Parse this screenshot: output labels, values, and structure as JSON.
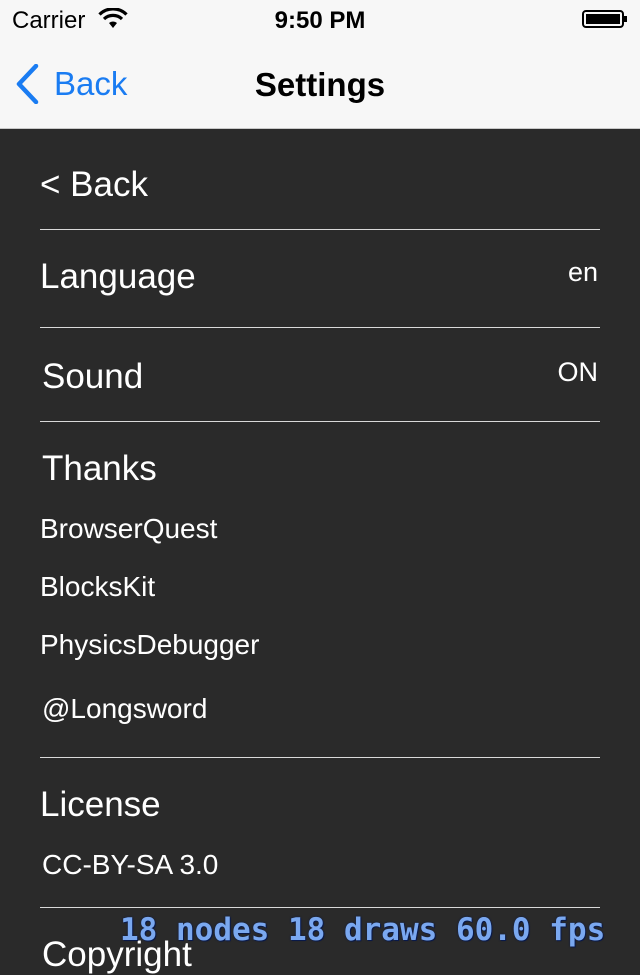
{
  "status_bar": {
    "carrier": "Carrier",
    "time": "9:50 PM"
  },
  "nav_bar": {
    "back_label": "Back",
    "title": "Settings"
  },
  "menu": {
    "back_label": "< Back",
    "language": {
      "label": "Language",
      "value": "en"
    },
    "sound": {
      "label": "Sound",
      "value": "ON"
    },
    "thanks": {
      "label": "Thanks",
      "items": [
        "BrowserQuest",
        "BlocksKit",
        "PhysicsDebugger",
        "@Longsword"
      ]
    },
    "license": {
      "label": "License",
      "value": "CC-BY-SA 3.0"
    },
    "copyright": {
      "label": "Copyright"
    }
  },
  "debug_overlay": "18 nodes 18 draws 60.0 fps",
  "colors": {
    "accent": "#1a7cf2",
    "background": "#2a2a2a",
    "bar": "#f7f7f7",
    "debug_text": "#7aa8f0"
  }
}
